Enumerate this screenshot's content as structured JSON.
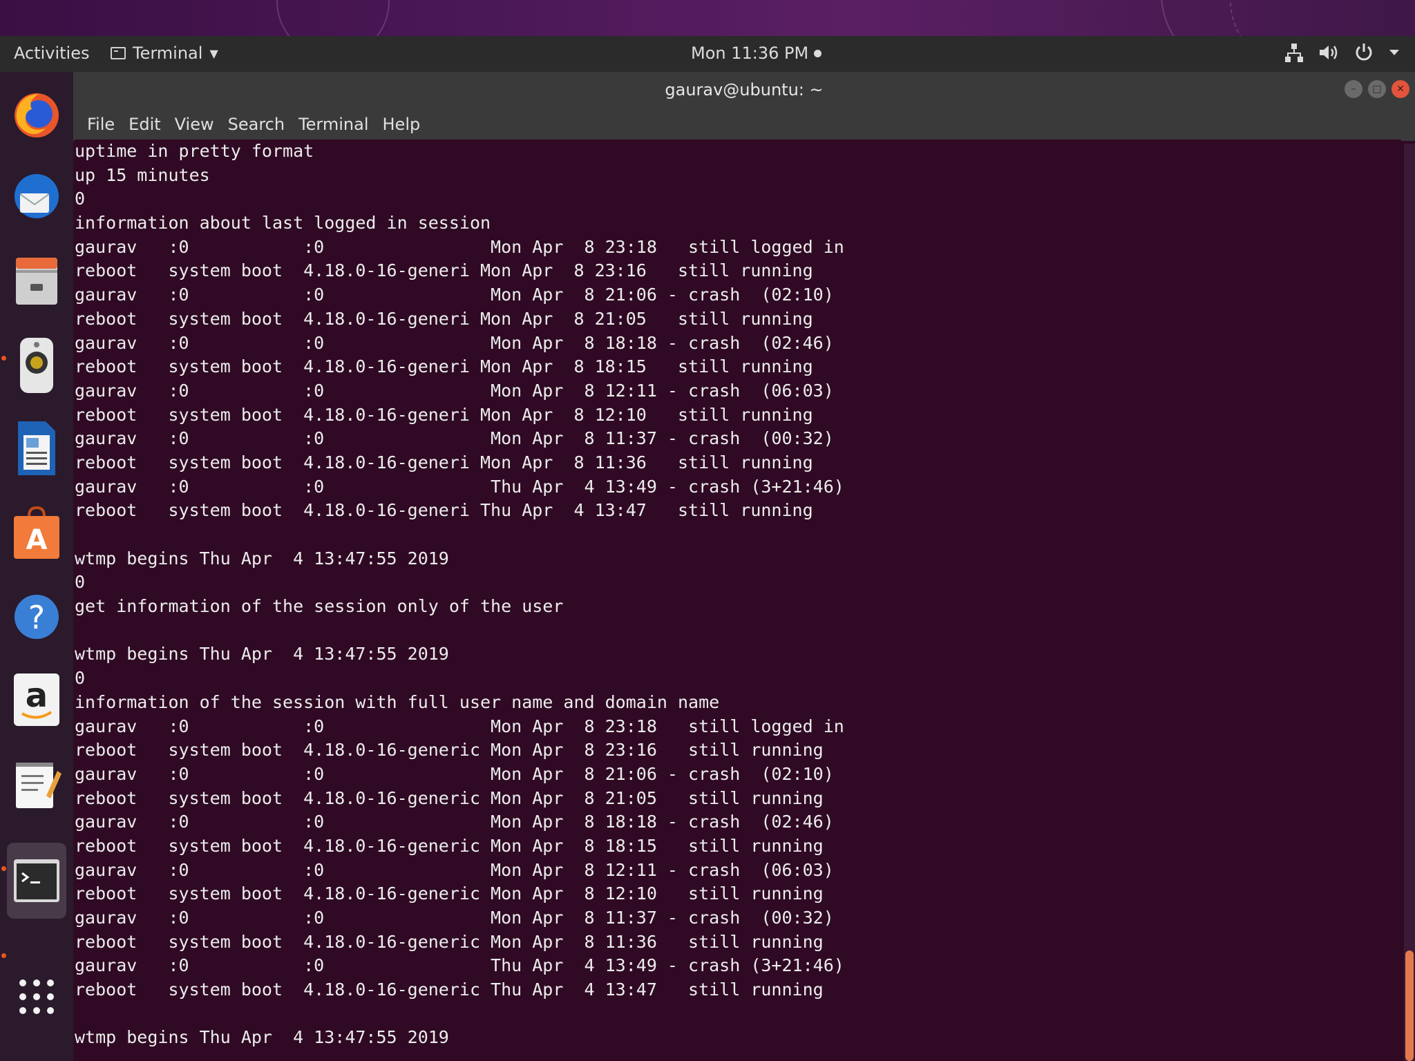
{
  "topbar": {
    "activities": "Activities",
    "app_name": "Terminal",
    "clock": "Mon 11:36 PM"
  },
  "dock": {
    "items": [
      {
        "name": "firefox",
        "icon": "firefox-icon"
      },
      {
        "name": "thunderbird",
        "icon": "mail-icon"
      },
      {
        "name": "files",
        "icon": "files-icon"
      },
      {
        "name": "rhythmbox",
        "icon": "speaker-icon"
      },
      {
        "name": "writer",
        "icon": "document-icon"
      },
      {
        "name": "software",
        "icon": "shopping-bag-icon"
      },
      {
        "name": "help",
        "icon": "help-icon"
      },
      {
        "name": "amazon",
        "icon": "amazon-icon"
      },
      {
        "name": "text-editor",
        "icon": "notepad-icon"
      },
      {
        "name": "terminal",
        "icon": "terminal-icon"
      },
      {
        "name": "show-applications",
        "icon": "grid-icon"
      }
    ],
    "accent": "#e95420"
  },
  "window": {
    "title": "gaurav@ubuntu: ~",
    "menu": [
      "File",
      "Edit",
      "View",
      "Search",
      "Terminal",
      "Help"
    ]
  },
  "terminal": {
    "background": "#300a24",
    "lines": [
      "uptime in pretty format",
      "up 15 minutes",
      "0",
      "information about last logged in session",
      "gaurav   :0           :0                Mon Apr  8 23:18   still logged in",
      "reboot   system boot  4.18.0-16-generi Mon Apr  8 23:16   still running",
      "gaurav   :0           :0                Mon Apr  8 21:06 - crash  (02:10)",
      "reboot   system boot  4.18.0-16-generi Mon Apr  8 21:05   still running",
      "gaurav   :0           :0                Mon Apr  8 18:18 - crash  (02:46)",
      "reboot   system boot  4.18.0-16-generi Mon Apr  8 18:15   still running",
      "gaurav   :0           :0                Mon Apr  8 12:11 - crash  (06:03)",
      "reboot   system boot  4.18.0-16-generi Mon Apr  8 12:10   still running",
      "gaurav   :0           :0                Mon Apr  8 11:37 - crash  (00:32)",
      "reboot   system boot  4.18.0-16-generi Mon Apr  8 11:36   still running",
      "gaurav   :0           :0                Thu Apr  4 13:49 - crash (3+21:46)",
      "reboot   system boot  4.18.0-16-generi Thu Apr  4 13:47   still running",
      "",
      "wtmp begins Thu Apr  4 13:47:55 2019",
      "0",
      "get information of the session only of the user",
      "",
      "wtmp begins Thu Apr  4 13:47:55 2019",
      "0",
      "information of the session with full user name and domain name",
      "gaurav   :0           :0                Mon Apr  8 23:18   still logged in",
      "reboot   system boot  4.18.0-16-generic Mon Apr  8 23:16   still running",
      "gaurav   :0           :0                Mon Apr  8 21:06 - crash  (02:10)",
      "reboot   system boot  4.18.0-16-generic Mon Apr  8 21:05   still running",
      "gaurav   :0           :0                Mon Apr  8 18:18 - crash  (02:46)",
      "reboot   system boot  4.18.0-16-generic Mon Apr  8 18:15   still running",
      "gaurav   :0           :0                Mon Apr  8 12:11 - crash  (06:03)",
      "reboot   system boot  4.18.0-16-generic Mon Apr  8 12:10   still running",
      "gaurav   :0           :0                Mon Apr  8 11:37 - crash  (00:32)",
      "reboot   system boot  4.18.0-16-generic Mon Apr  8 11:36   still running",
      "gaurav   :0           :0                Thu Apr  4 13:49 - crash (3+21:46)",
      "reboot   system boot  4.18.0-16-generic Thu Apr  4 13:47   still running",
      "",
      "wtmp begins Thu Apr  4 13:47:55 2019"
    ]
  }
}
